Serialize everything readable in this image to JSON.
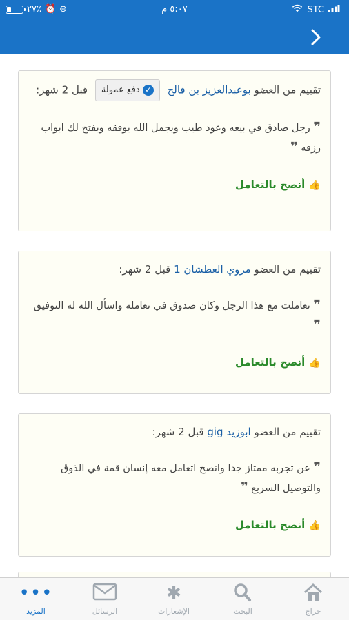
{
  "status_bar": {
    "carrier": "STC",
    "time": "٥:٠٧ م",
    "battery_percent_label": "٢٧٪",
    "battery_level": 0.27
  },
  "header": {
    "back_icon": "chevron-right-icon"
  },
  "reviews": [
    {
      "prefix": "تقييم من العضو",
      "member": "بوعبدالعزيز بن فالح",
      "badge": "دفع عمولة",
      "time": "قبل 2 شهر:",
      "quote": "رجل صادق في بيعه وعود طيب ويجمل الله يوفقه ويفتح لك ابواب رزقه",
      "recommend": "أنصح بالتعامل"
    },
    {
      "prefix": "تقييم من العضو",
      "member": "مروي العطشان 1",
      "time": "قبل 2 شهر:",
      "quote": "تعاملت مع هذا الرجل وكان صدوق في تعامله واسأل الله له التوفيق",
      "recommend": "أنصح بالتعامل"
    },
    {
      "prefix": "تقييم من العضو",
      "member": "ابوزيد gig",
      "time": "قبل 2 شهر:",
      "quote": "عن تجربه ممتاز جدا وانصح اتعامل معه إنسان قمة في الذوق والتوصيل السريع",
      "recommend": "أنصح بالتعامل"
    }
  ],
  "tabs": [
    {
      "label": "حراج",
      "icon": "home-icon"
    },
    {
      "label": "البحث",
      "icon": "search-icon"
    },
    {
      "label": "الإشعارات",
      "icon": "asterisk-icon"
    },
    {
      "label": "الرسائل",
      "icon": "envelope-icon"
    },
    {
      "label": "المزيد",
      "icon": "more-dots-icon",
      "active": true
    }
  ],
  "colors": {
    "primary": "#1a73c7",
    "recommend": "#2a8a2a",
    "link": "#1a5fa6"
  }
}
